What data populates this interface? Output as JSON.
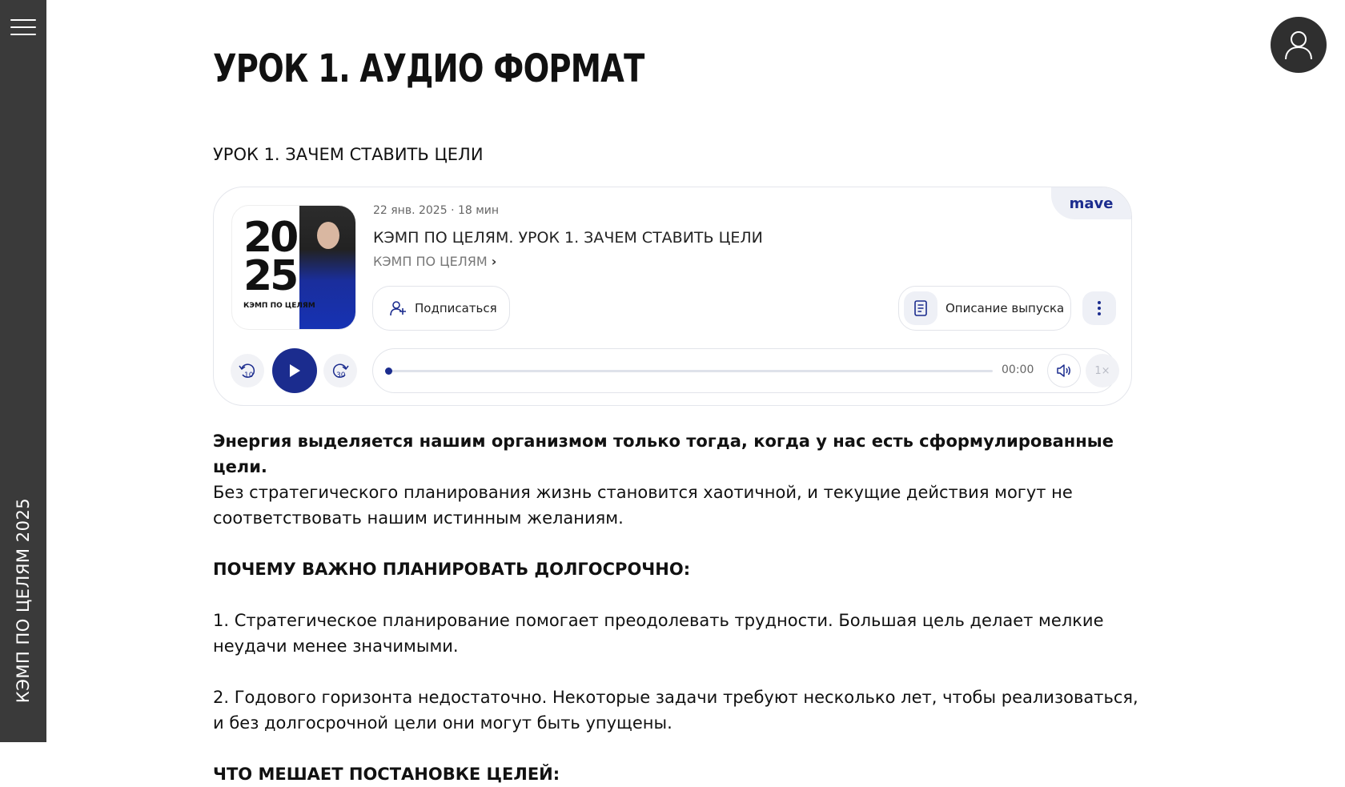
{
  "sidebar": {
    "vertical_title": "КЭМП ПО ЦЕЛЯМ 2025"
  },
  "page": {
    "title": "УРОК 1. АУДИО ФОРМАТ",
    "subtitle": "УРОК 1. ЗАЧЕМ СТАВИТЬ ЦЕЛИ"
  },
  "player": {
    "brand": "mave",
    "cover": {
      "line1": "20",
      "line2": "25",
      "caption": "КЭМП ПО ЦЕЛЯМ"
    },
    "meta": "22 янв. 2025 · 18 мин",
    "episode_title": "КЭМП ПО ЦЕЛЯМ. УРОК 1. ЗАЧЕМ СТАВИТЬ ЦЕЛИ",
    "podcast_name": "КЭМП ПО ЦЕЛЯМ",
    "subscribe_label": "Подписаться",
    "description_label": "Описание выпуска",
    "skip_back_label": "10",
    "skip_forward_label": "30",
    "current_time": "00:00",
    "speed": "1×",
    "progress": 0,
    "accent_color": "#1b2c8e"
  },
  "content": {
    "intro_bold": "Энергия выделяется нашим организмом только тогда, когда у нас есть сформулированные цели.",
    "intro_rest": "Без стратегического планирования жизнь становится хаотичной, и текущие действия могут не соответствовать нашим истинным желаниям.",
    "section1_heading": "ПОЧЕМУ ВАЖНО ПЛАНИРОВАТЬ ДОЛГОСРОЧНО:",
    "point1": "1. Стратегическое планирование помогает преодолевать трудности. Большая цель делает мелкие неудачи менее значимыми.",
    "point2": "2. Годового горизонта недостаточно. Некоторые задачи требуют несколько лет, чтобы реализоваться, и без долгосрочной цели они могут быть упущены.",
    "section2_heading": "ЧТО МЕШАЕТ ПОСТАНОВКЕ ЦЕЛЕЙ:"
  }
}
